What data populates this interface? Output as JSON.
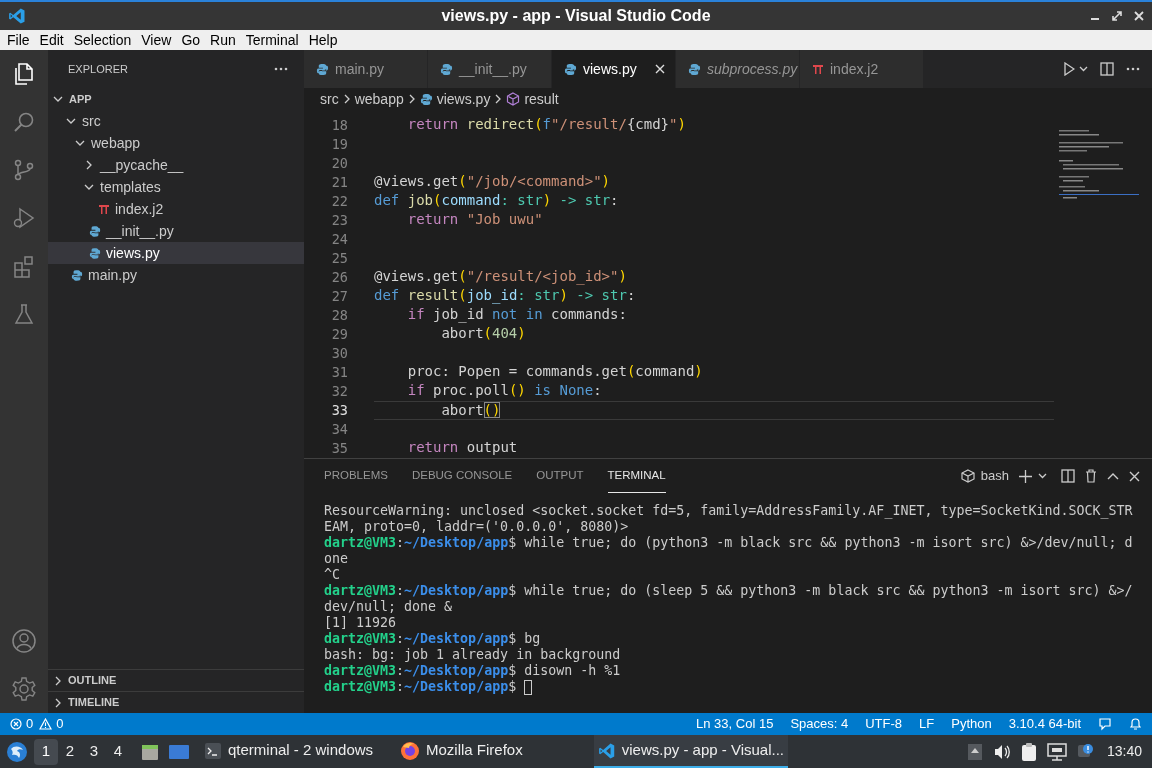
{
  "window": {
    "title": "views.py - app - Visual Studio Code"
  },
  "menu": [
    "File",
    "Edit",
    "Selection",
    "View",
    "Go",
    "Run",
    "Terminal",
    "Help"
  ],
  "activity_bar": {
    "top": [
      {
        "kind": "explorer",
        "selected": true
      },
      {
        "kind": "search",
        "selected": false
      },
      {
        "kind": "source-control",
        "selected": false
      },
      {
        "kind": "run",
        "selected": false
      },
      {
        "kind": "extensions",
        "selected": false
      },
      {
        "kind": "testing",
        "selected": false
      }
    ],
    "bottom": [
      {
        "kind": "account"
      },
      {
        "kind": "settings"
      }
    ]
  },
  "sidebar": {
    "title": "EXPLORER",
    "tree": [
      {
        "label": "APP",
        "kind": "root",
        "expanded": true,
        "selected": false,
        "children": [
          {
            "label": "src",
            "kind": "folder",
            "expanded": true,
            "selected": false,
            "children": [
              {
                "label": "webapp",
                "kind": "folder",
                "expanded": true,
                "selected": false,
                "children": [
                  {
                    "label": "__pycache__",
                    "kind": "folder",
                    "expanded": false,
                    "selected": false
                  },
                  {
                    "label": "templates",
                    "kind": "folder",
                    "expanded": true,
                    "selected": false,
                    "children": [
                      {
                        "label": "index.j2",
                        "kind": "jinja",
                        "selected": false
                      }
                    ]
                  },
                  {
                    "label": "__init__.py",
                    "kind": "python",
                    "selected": false
                  },
                  {
                    "label": "views.py",
                    "kind": "python",
                    "selected": true
                  }
                ]
              }
            ]
          },
          {
            "label": "main.py",
            "kind": "python",
            "selected": false
          }
        ]
      }
    ],
    "sections": [
      {
        "label": "OUTLINE",
        "expanded": false
      },
      {
        "label": "TIMELINE",
        "expanded": false
      }
    ]
  },
  "editor": {
    "tabs": [
      {
        "label": "main.py",
        "kind": "python",
        "selected": false,
        "preview": false
      },
      {
        "label": "__init__.py",
        "kind": "python",
        "selected": false,
        "preview": false
      },
      {
        "label": "views.py",
        "kind": "python",
        "selected": true,
        "preview": false
      },
      {
        "label": "subprocess.py",
        "kind": "python",
        "selected": false,
        "preview": true
      },
      {
        "label": "index.j2",
        "kind": "jinja",
        "selected": false,
        "preview": false
      }
    ],
    "breadcrumb": [
      {
        "label": "src",
        "kind": "folder"
      },
      {
        "label": "webapp",
        "kind": "folder"
      },
      {
        "label": "views.py",
        "kind": "python"
      },
      {
        "label": "result",
        "kind": "symbol"
      }
    ],
    "lines": [
      {
        "number": "18",
        "current": false,
        "tokens": [
          {
            "text": "    return ",
            "kind": "kw"
          },
          {
            "text": "redirect",
            "kind": "fn"
          },
          {
            "text": "(",
            "kind": "br"
          },
          {
            "text": "f",
            "kind": "def"
          },
          {
            "text": "\"/result/",
            "kind": "str"
          },
          {
            "text": "{cmd}",
            "kind": "p"
          },
          {
            "text": "\"",
            "kind": "str"
          },
          {
            "text": ")",
            "kind": "br"
          }
        ]
      },
      {
        "number": "19",
        "current": false
      },
      {
        "number": "20",
        "current": false
      },
      {
        "number": "21",
        "current": false,
        "tokens": [
          {
            "text": "@views.get",
            "kind": "p"
          },
          {
            "text": "(",
            "kind": "br"
          },
          {
            "text": "\"/job/<command>\"",
            "kind": "str"
          },
          {
            "text": ")",
            "kind": "br"
          }
        ]
      },
      {
        "number": "22",
        "current": false,
        "tokens": [
          {
            "text": "def ",
            "kind": "def"
          },
          {
            "text": "job",
            "kind": "fn"
          },
          {
            "text": "(",
            "kind": "br"
          },
          {
            "text": "command",
            "kind": "var"
          },
          {
            "text": ": str",
            "kind": "type"
          },
          {
            "text": ")",
            "kind": "br"
          },
          {
            "text": " -> str",
            "kind": "type"
          },
          {
            "text": ":",
            "kind": "p"
          }
        ]
      },
      {
        "number": "23",
        "current": false,
        "tokens": [
          {
            "text": "    return ",
            "kind": "kw"
          },
          {
            "text": "\"Job uwu\"",
            "kind": "str"
          }
        ]
      },
      {
        "number": "24",
        "current": false
      },
      {
        "number": "25",
        "current": false
      },
      {
        "number": "26",
        "current": false,
        "tokens": [
          {
            "text": "@views.get",
            "kind": "p"
          },
          {
            "text": "(",
            "kind": "br"
          },
          {
            "text": "\"/result/<job_id>\"",
            "kind": "str"
          },
          {
            "text": ")",
            "kind": "br"
          }
        ]
      },
      {
        "number": "27",
        "current": false,
        "tokens": [
          {
            "text": "def ",
            "kind": "def"
          },
          {
            "text": "result",
            "kind": "fn"
          },
          {
            "text": "(",
            "kind": "br"
          },
          {
            "text": "job_id",
            "kind": "var"
          },
          {
            "text": ": str",
            "kind": "type"
          },
          {
            "text": ")",
            "kind": "br"
          },
          {
            "text": " -> str",
            "kind": "type"
          },
          {
            "text": ":",
            "kind": "p"
          }
        ]
      },
      {
        "number": "28",
        "current": false,
        "tokens": [
          {
            "text": "    if",
            "kind": "kw"
          },
          {
            "text": " job_id ",
            "kind": "p"
          },
          {
            "text": "not in",
            "kind": "def"
          },
          {
            "text": " commands:",
            "kind": "p"
          }
        ]
      },
      {
        "number": "29",
        "current": false,
        "tokens": [
          {
            "text": "        abort",
            "kind": "p"
          },
          {
            "text": "(",
            "kind": "br"
          },
          {
            "text": "404",
            "kind": "num"
          },
          {
            "text": ")",
            "kind": "br"
          }
        ]
      },
      {
        "number": "30",
        "current": false
      },
      {
        "number": "31",
        "current": false,
        "tokens": [
          {
            "text": "    proc: Popen = commands.get",
            "kind": "p"
          },
          {
            "text": "(",
            "kind": "br"
          },
          {
            "text": "command",
            "kind": "p"
          },
          {
            "text": ")",
            "kind": "br"
          }
        ]
      },
      {
        "number": "32",
        "current": false,
        "tokens": [
          {
            "text": "    if",
            "kind": "kw"
          },
          {
            "text": " proc.poll",
            "kind": "p"
          },
          {
            "text": "()",
            "kind": "br"
          },
          {
            "text": " is None",
            "kind": "def"
          },
          {
            "text": ":",
            "kind": "p"
          }
        ]
      },
      {
        "number": "33",
        "current": true,
        "tokens": [
          {
            "text": "        abort",
            "kind": "p"
          },
          {
            "text": "()",
            "kind": "match"
          }
        ]
      },
      {
        "number": "34",
        "current": false
      },
      {
        "number": "35",
        "current": false,
        "tokens": [
          {
            "text": "    return",
            "kind": "kw"
          },
          {
            "text": " output",
            "kind": "p"
          }
        ]
      }
    ]
  },
  "panel": {
    "tabs": [
      {
        "label": "PROBLEMS",
        "selected": false
      },
      {
        "label": "DEBUG CONSOLE",
        "selected": false
      },
      {
        "label": "OUTPUT",
        "selected": false
      },
      {
        "label": "TERMINAL",
        "selected": true
      }
    ],
    "shell": "bash",
    "cursor": true,
    "lines": [
      [
        {
          "text": "ResourceWarning: unclosed <socket.socket fd=5, family=AddressFamily.AF_INET, type=SocketKind.SOCK_STR",
          "kind": "p"
        }
      ],
      [
        {
          "text": "EAM, proto=0, laddr=('0.0.0.0', 8080)>",
          "kind": "p"
        }
      ],
      [
        {
          "text": "dartz@VM3",
          "kind": "user"
        },
        {
          "text": ":",
          "kind": "p"
        },
        {
          "text": "~/Desktop/app",
          "kind": "path"
        },
        {
          "text": "$ while true; do (python3 -m black src && python3 -m isort src) &>/dev/null; d",
          "kind": "p"
        }
      ],
      [
        {
          "text": "one",
          "kind": "p"
        }
      ],
      [
        {
          "text": "^C",
          "kind": "p"
        }
      ],
      [
        {
          "text": "dartz@VM3",
          "kind": "user"
        },
        {
          "text": ":",
          "kind": "p"
        },
        {
          "text": "~/Desktop/app",
          "kind": "path"
        },
        {
          "text": "$ while true; do (sleep 5 && python3 -m black src && python3 -m isort src) &>/",
          "kind": "p"
        }
      ],
      [
        {
          "text": "dev/null; done &",
          "kind": "p"
        }
      ],
      [
        {
          "text": "[1] 11926",
          "kind": "p"
        }
      ],
      [
        {
          "text": "dartz@VM3",
          "kind": "user"
        },
        {
          "text": ":",
          "kind": "p"
        },
        {
          "text": "~/Desktop/app",
          "kind": "path"
        },
        {
          "text": "$ bg",
          "kind": "p"
        }
      ],
      [
        {
          "text": "bash: bg: job 1 already in background",
          "kind": "p"
        }
      ],
      [
        {
          "text": "dartz@VM3",
          "kind": "user"
        },
        {
          "text": ":",
          "kind": "p"
        },
        {
          "text": "~/Desktop/app",
          "kind": "path"
        },
        {
          "text": "$ disown -h %1",
          "kind": "p"
        }
      ],
      [
        {
          "text": "dartz@VM3",
          "kind": "user"
        },
        {
          "text": ":",
          "kind": "p"
        },
        {
          "text": "~/Desktop/app",
          "kind": "path"
        },
        {
          "text": "$",
          "kind": "p"
        }
      ]
    ]
  },
  "status_bar": {
    "errors": "0",
    "warnings": "0",
    "items": [
      "Ln 33, Col 15",
      "Spaces: 4",
      "UTF-8",
      "LF",
      "Python",
      "3.10.4 64-bit"
    ]
  },
  "taskbar": {
    "workspaces": [
      {
        "label": "1",
        "selected": true
      },
      {
        "label": "2",
        "selected": false
      },
      {
        "label": "3",
        "selected": false
      },
      {
        "label": "4",
        "selected": false
      }
    ],
    "tasks": [
      {
        "label": "qterminal - 2 windows",
        "kind": "terminal",
        "selected": false
      },
      {
        "label": "Mozilla Firefox",
        "kind": "browser",
        "selected": false
      },
      {
        "label": "views.py - app - Visual...",
        "kind": "editor",
        "selected": true
      }
    ],
    "clock": "13:40"
  }
}
